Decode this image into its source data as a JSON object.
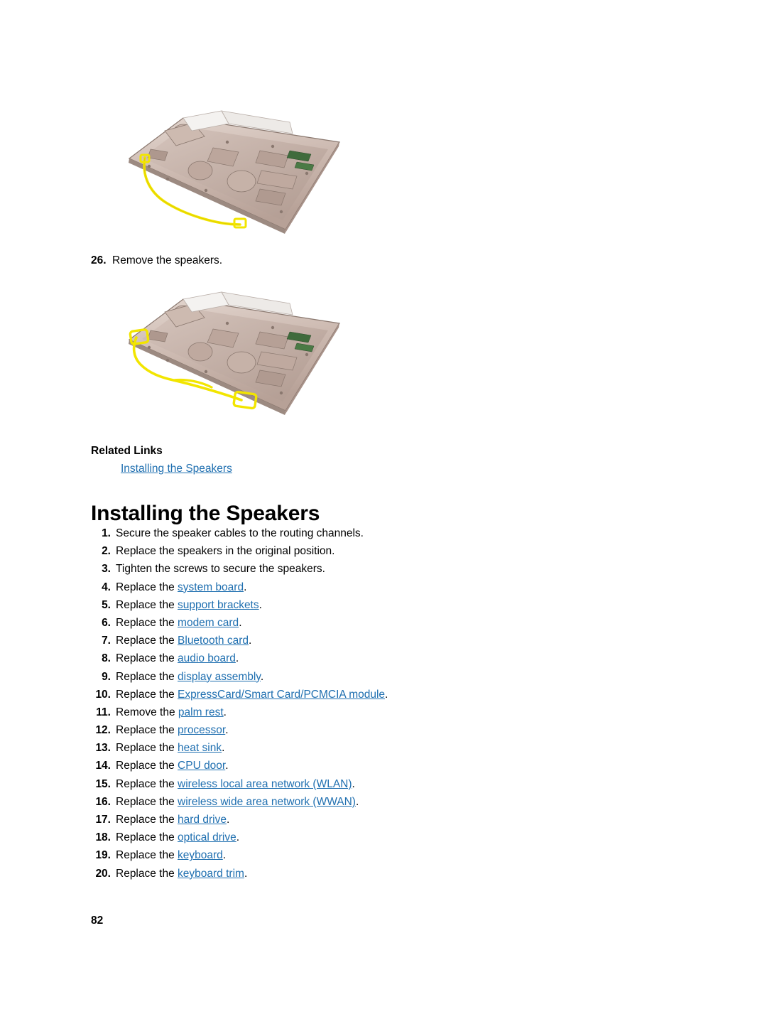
{
  "figures": [
    {
      "name": "laptop-base-speakers-routing-figure",
      "caption": ""
    },
    {
      "name": "laptop-base-speakers-removed-figure",
      "caption": ""
    }
  ],
  "remove_step": {
    "number": "26.",
    "text": "Remove the speakers."
  },
  "related_links": {
    "heading": "Related Links",
    "items": [
      "Installing the Speakers"
    ]
  },
  "section": {
    "title": "Installing the Speakers"
  },
  "steps": [
    {
      "n": "1.",
      "pre": "Secure the speaker cables to the routing channels.",
      "link": "",
      "post": ""
    },
    {
      "n": "2.",
      "pre": "Replace the speakers in the original position.",
      "link": "",
      "post": ""
    },
    {
      "n": "3.",
      "pre": "Tighten the screws to secure the speakers.",
      "link": "",
      "post": ""
    },
    {
      "n": "4.",
      "pre": "Replace the ",
      "link": "system board",
      "post": "."
    },
    {
      "n": "5.",
      "pre": "Replace the ",
      "link": "support brackets",
      "post": "."
    },
    {
      "n": "6.",
      "pre": "Replace the ",
      "link": "modem card",
      "post": "."
    },
    {
      "n": "7.",
      "pre": "Replace the ",
      "link": "Bluetooth card",
      "post": "."
    },
    {
      "n": "8.",
      "pre": "Replace the ",
      "link": "audio board",
      "post": "."
    },
    {
      "n": "9.",
      "pre": "Replace the ",
      "link": "display assembly",
      "post": "."
    },
    {
      "n": "10.",
      "pre": "Replace the ",
      "link": "ExpressCard/Smart Card/PCMCIA module",
      "post": "."
    },
    {
      "n": "11.",
      "pre": "Remove the ",
      "link": "palm rest",
      "post": "."
    },
    {
      "n": "12.",
      "pre": "Replace the ",
      "link": "processor",
      "post": "."
    },
    {
      "n": "13.",
      "pre": "Replace the ",
      "link": "heat sink",
      "post": "."
    },
    {
      "n": "14.",
      "pre": "Replace the ",
      "link": "CPU door",
      "post": "."
    },
    {
      "n": "15.",
      "pre": "Replace the ",
      "link": "wireless local area network (WLAN)",
      "post": "."
    },
    {
      "n": "16.",
      "pre": "Replace the ",
      "link": "wireless wide area network (WWAN)",
      "post": "."
    },
    {
      "n": "17.",
      "pre": "Replace the ",
      "link": "hard drive",
      "post": "."
    },
    {
      "n": "18.",
      "pre": "Replace the ",
      "link": "optical drive",
      "post": "."
    },
    {
      "n": "19.",
      "pre": "Replace the ",
      "link": "keyboard",
      "post": "."
    },
    {
      "n": "20.",
      "pre": "Replace the ",
      "link": "keyboard trim",
      "post": "."
    }
  ],
  "page_number": "82",
  "colors": {
    "link": "#1F6FB0",
    "highlight": "#F2E500",
    "chassis_light": "#D9C9C2",
    "chassis_mid": "#C4AFA6",
    "chassis_dark": "#8C7A72"
  }
}
